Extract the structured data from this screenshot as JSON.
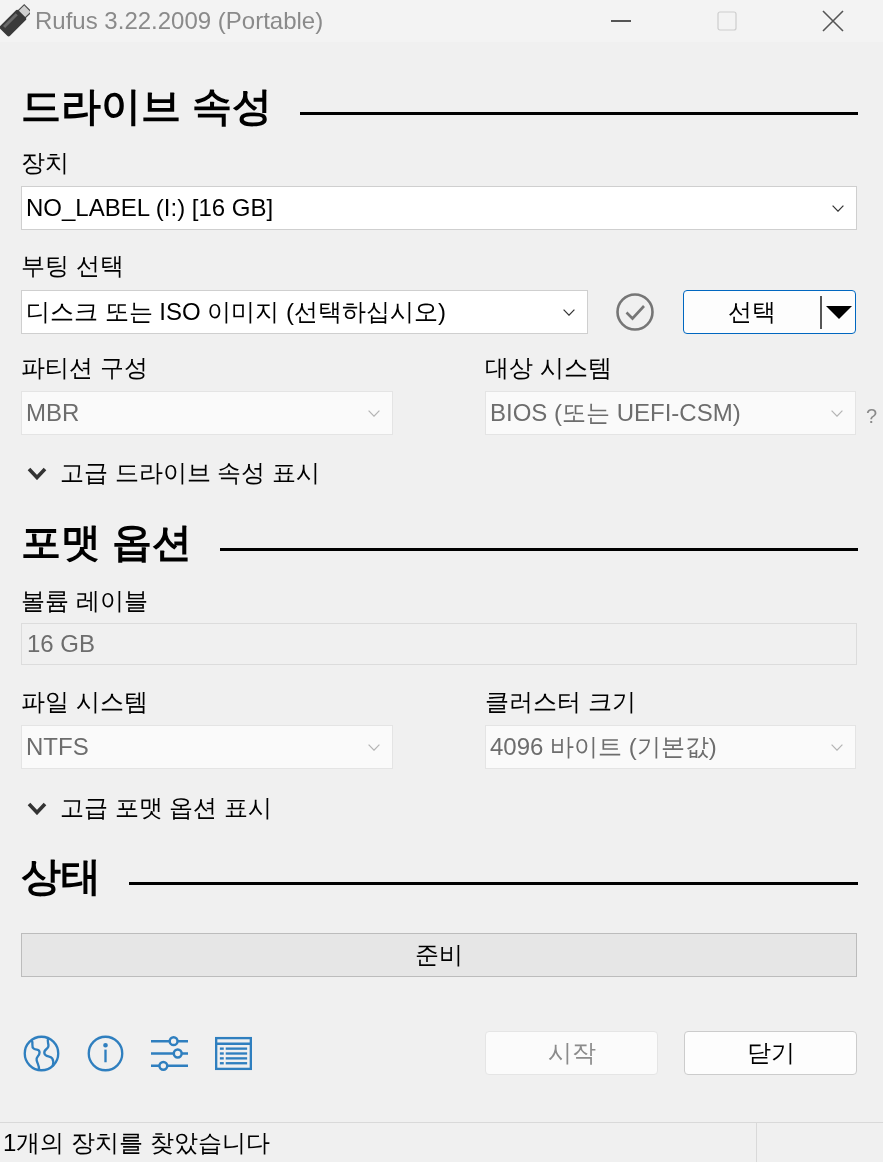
{
  "window": {
    "title": "Rufus 3.22.2009 (Portable)",
    "controls": [
      {
        "kind": "minimize",
        "disabled": false
      },
      {
        "kind": "maximize",
        "disabled": true
      },
      {
        "kind": "close",
        "disabled": false
      }
    ]
  },
  "drive_properties": {
    "heading": "드라이브 속성",
    "device": {
      "label": "장치",
      "value": "NO_LABEL (I:) [16 GB]",
      "disabled": false
    },
    "boot_selection": {
      "label": "부팅 선택",
      "value": "디스크 또는 ISO 이미지 (선택하십시오)",
      "disabled": false,
      "button": "선택"
    },
    "partition_scheme": {
      "label": "파티션 구성",
      "value": "MBR",
      "disabled": true
    },
    "target_system": {
      "label": "대상 시스템",
      "value": "BIOS (또는 UEFI-CSM)",
      "disabled": true,
      "help": "?"
    },
    "advanced_toggle": {
      "label": "고급 드라이브 속성 표시",
      "expanded": false
    }
  },
  "format_options": {
    "heading": "포맷 옵션",
    "volume_label": {
      "label": "볼륨 레이블",
      "value": "16 GB",
      "disabled": true
    },
    "file_system": {
      "label": "파일 시스템",
      "value": "NTFS",
      "disabled": true
    },
    "cluster_size": {
      "label": "클러스터 크기",
      "value": "4096 바이트 (기본값)",
      "disabled": true
    },
    "advanced_toggle": {
      "label": "고급 포맷 옵션 표시",
      "expanded": false
    }
  },
  "status": {
    "heading": "상태",
    "progress": {
      "text": "준비",
      "level": 0
    }
  },
  "buttons": [
    {
      "label": "시작",
      "disabled": true
    },
    {
      "label": "닫기",
      "disabled": false
    }
  ],
  "status_bar": {
    "text": "1개의 장치를 찾았습니다"
  }
}
